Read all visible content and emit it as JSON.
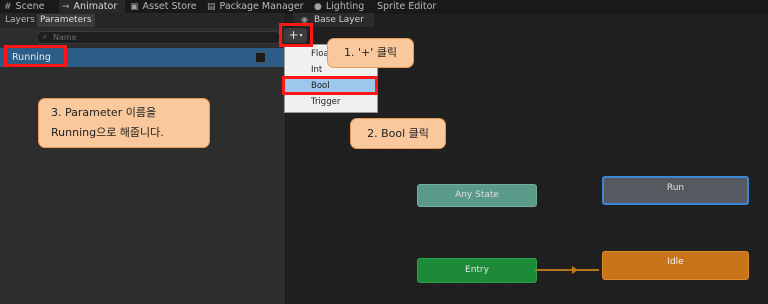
{
  "tabs": [
    {
      "label": "Scene",
      "icon": "scene-grid-icon",
      "active": false
    },
    {
      "label": "Animator",
      "icon": "animator-icon",
      "active": true
    },
    {
      "label": "Asset Store",
      "icon": "shopping-bag-icon",
      "active": false
    },
    {
      "label": "Package Manager",
      "icon": "package-icon",
      "active": false
    },
    {
      "label": "Lighting",
      "icon": "lightbulb-icon",
      "active": false
    },
    {
      "label": "Sprite Editor",
      "icon": "",
      "active": false
    }
  ],
  "left_panel": {
    "subtabs": [
      {
        "label": "Layers",
        "active": false
      },
      {
        "label": "Parameters",
        "active": true
      }
    ],
    "search_placeholder": "Name",
    "parameter": {
      "name": "Running",
      "type": "Bool",
      "checked": false
    }
  },
  "graph": {
    "breadcrumb": "Base Layer",
    "states": {
      "any_state": "Any State",
      "entry": "Entry",
      "run": "Run",
      "idle": "Idle"
    }
  },
  "add_button": {
    "label": "+",
    "caret": "▾"
  },
  "dropdown": {
    "items": [
      {
        "label": "Float",
        "selected": false
      },
      {
        "label": "Int",
        "selected": false
      },
      {
        "label": "Bool",
        "selected": true
      },
      {
        "label": "Trigger",
        "selected": false
      }
    ]
  },
  "callouts": {
    "step1": "1. '+' 클릭",
    "step2": "2. Bool 클릭",
    "step3_line1": "3. Parameter 이름을",
    "step3_line2": "Running으로 해줍니다."
  },
  "colors": {
    "accent_red": "#ff1616",
    "callout_bg": "#f9c89d",
    "selected_row": "#2c5d87",
    "entry_state": "#1d8a3a",
    "default_state": "#c8741a",
    "any_state": "#5a9a88",
    "run_state": "#555a60"
  }
}
